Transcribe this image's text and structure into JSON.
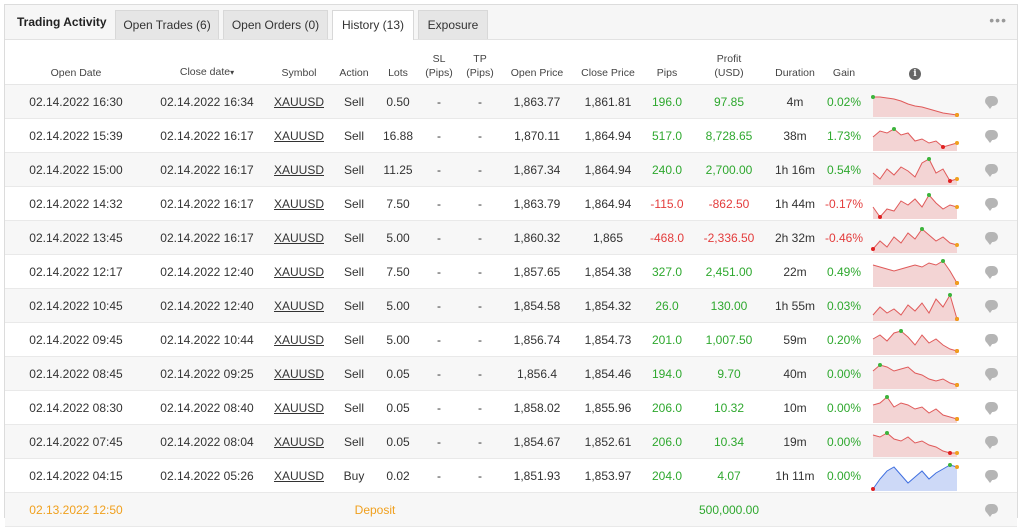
{
  "tabs": {
    "title": "Trading Activity",
    "items": [
      {
        "label": "Open Trades (6)"
      },
      {
        "label": "Open Orders (0)"
      },
      {
        "label": "History (13)"
      },
      {
        "label": "Exposure"
      }
    ],
    "active": "History (13)"
  },
  "columns": {
    "open_date": "Open Date",
    "close_date": "Close date",
    "sort_indicator": "▾",
    "symbol": "Symbol",
    "action": "Action",
    "lots": "Lots",
    "sl": "SL",
    "sl_unit": "(Pips)",
    "tp": "TP",
    "tp_unit": "(Pips)",
    "open_price": "Open Price",
    "close_price": "Close Price",
    "pips": "Pips",
    "profit": "Profit",
    "profit_unit": "(USD)",
    "duration": "Duration",
    "gain": "Gain",
    "info_icon": "info-icon"
  },
  "rows": [
    {
      "open": "02.14.2022 16:30",
      "close": "02.14.2022 16:34",
      "symbol": "XAUUSD",
      "action": "Sell",
      "lots": "0.50",
      "sl": "-",
      "tp": "-",
      "open_price": "1,863.77",
      "close_price": "1,861.81",
      "pips": "196.0",
      "profit": "97.85",
      "duration": "4m",
      "gain": "0.02%",
      "positive": true,
      "spark": [
        10,
        10,
        11,
        12,
        14,
        17,
        19,
        20,
        22,
        24,
        26,
        27,
        28
      ],
      "spark_type": "sell"
    },
    {
      "open": "02.14.2022 15:39",
      "close": "02.14.2022 16:17",
      "symbol": "XAUUSD",
      "action": "Sell",
      "lots": "16.88",
      "sl": "-",
      "tp": "-",
      "open_price": "1,870.11",
      "close_price": "1,864.94",
      "pips": "517.0",
      "profit": "8,728.65",
      "duration": "38m",
      "gain": "1.73%",
      "positive": true,
      "spark": [
        16,
        10,
        12,
        8,
        14,
        12,
        20,
        18,
        22,
        20,
        26,
        24,
        22
      ],
      "spark_type": "sell"
    },
    {
      "open": "02.14.2022 15:00",
      "close": "02.14.2022 16:17",
      "symbol": "XAUUSD",
      "action": "Sell",
      "lots": "11.25",
      "sl": "-",
      "tp": "-",
      "open_price": "1,867.34",
      "close_price": "1,864.94",
      "pips": "240.0",
      "profit": "2,700.00",
      "duration": "1h 16m",
      "gain": "0.54%",
      "positive": true,
      "spark": [
        18,
        24,
        14,
        20,
        12,
        16,
        22,
        8,
        4,
        18,
        14,
        26,
        24
      ],
      "spark_type": "sell"
    },
    {
      "open": "02.14.2022 14:32",
      "close": "02.14.2022 16:17",
      "symbol": "XAUUSD",
      "action": "Sell",
      "lots": "7.50",
      "sl": "-",
      "tp": "-",
      "open_price": "1,863.79",
      "close_price": "1,864.94",
      "pips": "-115.0",
      "profit": "-862.50",
      "duration": "1h 44m",
      "gain": "-0.17%",
      "positive": false,
      "spark": [
        18,
        28,
        20,
        22,
        12,
        16,
        10,
        18,
        6,
        14,
        20,
        16,
        18
      ],
      "spark_type": "sell"
    },
    {
      "open": "02.14.2022 13:45",
      "close": "02.14.2022 16:17",
      "symbol": "XAUUSD",
      "action": "Sell",
      "lots": "5.00",
      "sl": "-",
      "tp": "-",
      "open_price": "1,860.32",
      "close_price": "1,865",
      "pips": "-468.0",
      "profit": "-2,336.50",
      "duration": "2h 32m",
      "gain": "-0.46%",
      "positive": false,
      "spark": [
        26,
        18,
        24,
        14,
        20,
        10,
        16,
        6,
        12,
        18,
        14,
        20,
        22
      ],
      "spark_type": "sell"
    },
    {
      "open": "02.14.2022 12:17",
      "close": "02.14.2022 12:40",
      "symbol": "XAUUSD",
      "action": "Sell",
      "lots": "7.50",
      "sl": "-",
      "tp": "-",
      "open_price": "1,857.65",
      "close_price": "1,854.38",
      "pips": "327.0",
      "profit": "2,451.00",
      "duration": "22m",
      "gain": "0.49%",
      "positive": true,
      "spark": [
        8,
        10,
        12,
        14,
        12,
        10,
        8,
        10,
        6,
        8,
        4,
        14,
        26
      ],
      "spark_type": "sell"
    },
    {
      "open": "02.14.2022 10:45",
      "close": "02.14.2022 12:40",
      "symbol": "XAUUSD",
      "action": "Sell",
      "lots": "5.00",
      "sl": "-",
      "tp": "-",
      "open_price": "1,854.58",
      "close_price": "1,854.32",
      "pips": "26.0",
      "profit": "130.00",
      "duration": "1h 55m",
      "gain": "0.03%",
      "positive": true,
      "spark": [
        24,
        16,
        22,
        18,
        24,
        14,
        20,
        12,
        22,
        8,
        16,
        4,
        28
      ],
      "spark_type": "sell"
    },
    {
      "open": "02.14.2022 09:45",
      "close": "02.14.2022 10:44",
      "symbol": "XAUUSD",
      "action": "Sell",
      "lots": "5.00",
      "sl": "-",
      "tp": "-",
      "open_price": "1,856.74",
      "close_price": "1,854.73",
      "pips": "201.0",
      "profit": "1,007.50",
      "duration": "59m",
      "gain": "0.20%",
      "positive": true,
      "spark": [
        14,
        10,
        16,
        8,
        6,
        12,
        20,
        10,
        18,
        14,
        20,
        24,
        26
      ],
      "spark_type": "sell"
    },
    {
      "open": "02.14.2022 08:45",
      "close": "02.14.2022 09:25",
      "symbol": "XAUUSD",
      "action": "Sell",
      "lots": "0.05",
      "sl": "-",
      "tp": "-",
      "open_price": "1,856.4",
      "close_price": "1,854.46",
      "pips": "194.0",
      "profit": "9.70",
      "duration": "40m",
      "gain": "0.00%",
      "positive": true,
      "spark": [
        12,
        6,
        8,
        12,
        10,
        8,
        14,
        16,
        20,
        22,
        20,
        24,
        26
      ],
      "spark_type": "sell"
    },
    {
      "open": "02.14.2022 08:30",
      "close": "02.14.2022 08:40",
      "symbol": "XAUUSD",
      "action": "Sell",
      "lots": "0.05",
      "sl": "-",
      "tp": "-",
      "open_price": "1,858.02",
      "close_price": "1,855.96",
      "pips": "206.0",
      "profit": "10.32",
      "duration": "10m",
      "gain": "0.00%",
      "positive": true,
      "spark": [
        12,
        10,
        4,
        14,
        10,
        12,
        16,
        14,
        20,
        16,
        22,
        24,
        26
      ],
      "spark_type": "sell"
    },
    {
      "open": "02.14.2022 07:45",
      "close": "02.14.2022 08:04",
      "symbol": "XAUUSD",
      "action": "Sell",
      "lots": "0.05",
      "sl": "-",
      "tp": "-",
      "open_price": "1,854.67",
      "close_price": "1,852.61",
      "pips": "206.0",
      "profit": "10.34",
      "duration": "19m",
      "gain": "0.00%",
      "positive": true,
      "spark": [
        8,
        10,
        6,
        12,
        14,
        10,
        16,
        14,
        18,
        20,
        24,
        26,
        26
      ],
      "spark_type": "sell"
    },
    {
      "open": "02.14.2022 04:15",
      "close": "02.14.2022 05:26",
      "symbol": "XAUUSD",
      "action": "Buy",
      "lots": "0.02",
      "sl": "-",
      "tp": "-",
      "open_price": "1,851.93",
      "close_price": "1,853.97",
      "pips": "204.0",
      "profit": "4.07",
      "duration": "1h 11m",
      "gain": "0.00%",
      "positive": true,
      "spark": [
        28,
        18,
        10,
        6,
        14,
        22,
        16,
        10,
        18,
        12,
        8,
        4,
        6
      ],
      "spark_type": "buy"
    }
  ],
  "deposit": {
    "date": "02.13.2022 12:50",
    "label": "Deposit",
    "amount": "500,000.00"
  },
  "colors": {
    "positive": "#2ea82e",
    "negative": "#e33c3c",
    "deposit": "#f0a01e",
    "sell_line": "#e05a5a",
    "sell_fill": "#f3d4d4",
    "buy_line": "#3f6fe0",
    "buy_fill": "#cdd9f7",
    "marker_green": "#3cb43c",
    "marker_red": "#e02020",
    "marker_orange": "#f0a01e"
  }
}
